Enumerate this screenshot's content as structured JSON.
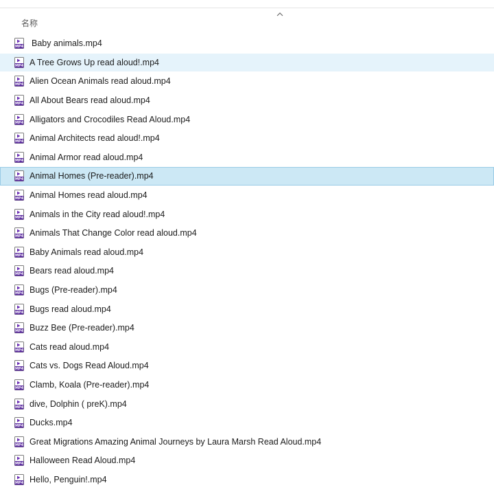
{
  "header": {
    "column_name": "名称",
    "sort_icon": "chevron-up-icon"
  },
  "colors": {
    "hover_background": "#e5f3fb",
    "selected_background": "#cce8f5",
    "selected_border": "#99cbe6",
    "mp4_icon_accent": "#6b2fb5"
  },
  "files": [
    {
      "name": "Baby animals.mp4",
      "state": "normal",
      "icon": "mp4-video-file-icon"
    },
    {
      "name": "A Tree Grows Up read aloud!.mp4",
      "state": "hover",
      "icon": "mp4-video-file-icon"
    },
    {
      "name": "Alien Ocean Animals read aloud.mp4",
      "state": "normal",
      "icon": "mp4-video-file-icon"
    },
    {
      "name": "All About Bears read aloud.mp4",
      "state": "normal",
      "icon": "mp4-video-file-icon"
    },
    {
      "name": "Alligators and Crocodiles Read Aloud.mp4",
      "state": "normal",
      "icon": "mp4-video-file-icon"
    },
    {
      "name": "Animal Architects read aloud!.mp4",
      "state": "normal",
      "icon": "mp4-video-file-icon"
    },
    {
      "name": "Animal Armor read aloud.mp4",
      "state": "normal",
      "icon": "mp4-video-file-icon"
    },
    {
      "name": "Animal Homes (Pre-reader).mp4",
      "state": "selected",
      "icon": "mp4-video-file-icon"
    },
    {
      "name": "Animal Homes read aloud.mp4",
      "state": "normal",
      "icon": "mp4-video-file-icon"
    },
    {
      "name": "Animals in the City read aloud!.mp4",
      "state": "normal",
      "icon": "mp4-video-file-icon"
    },
    {
      "name": "Animals That Change Color read aloud.mp4",
      "state": "normal",
      "icon": "mp4-video-file-icon"
    },
    {
      "name": "Baby Animals read aloud.mp4",
      "state": "normal",
      "icon": "mp4-video-file-icon"
    },
    {
      "name": "Bears read aloud.mp4",
      "state": "normal",
      "icon": "mp4-video-file-icon"
    },
    {
      "name": "Bugs (Pre-reader).mp4",
      "state": "normal",
      "icon": "mp4-video-file-icon"
    },
    {
      "name": "Bugs read aloud.mp4",
      "state": "normal",
      "icon": "mp4-video-file-icon"
    },
    {
      "name": "Buzz Bee (Pre-reader).mp4",
      "state": "normal",
      "icon": "mp4-video-file-icon"
    },
    {
      "name": "Cats read aloud.mp4",
      "state": "normal",
      "icon": "mp4-video-file-icon"
    },
    {
      "name": "Cats vs. Dogs Read Aloud.mp4",
      "state": "normal",
      "icon": "mp4-video-file-icon"
    },
    {
      "name": "Clamb, Koala (Pre-reader).mp4",
      "state": "normal",
      "icon": "mp4-video-file-icon"
    },
    {
      "name": "dive, Dolphin ( preK).mp4",
      "state": "normal",
      "icon": "mp4-video-file-icon"
    },
    {
      "name": "Ducks.mp4",
      "state": "normal",
      "icon": "mp4-video-file-icon"
    },
    {
      "name": "Great Migrations Amazing Animal Journeys by Laura Marsh Read Aloud.mp4",
      "state": "normal",
      "icon": "mp4-video-file-icon"
    },
    {
      "name": "Halloween Read Aloud.mp4",
      "state": "normal",
      "icon": "mp4-video-file-icon"
    },
    {
      "name": "Hello, Penguin!.mp4",
      "state": "normal",
      "icon": "mp4-video-file-icon"
    }
  ]
}
